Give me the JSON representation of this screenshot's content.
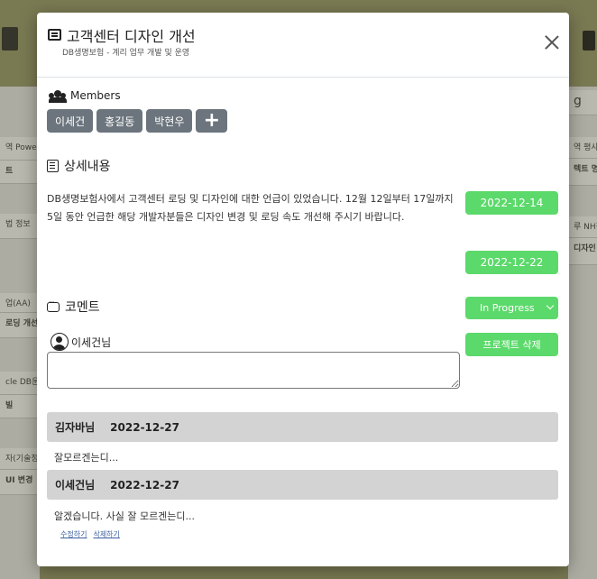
{
  "background": {
    "left_cards": [
      "역 Powe",
      "트",
      "법 정보",
      "업(AA)",
      "로딩 개선",
      "cle DB운",
      "빌",
      "자(기술정",
      "UI 변경"
    ],
    "right_cards": [
      "g",
      "역 평사",
      "텍트 명",
      "루 NH펌",
      "디자인 변"
    ]
  },
  "modal": {
    "title": "고객센터 디자인 개선",
    "subtitle": "DB생명보험 - 계리 업무 개발 및 운영",
    "members_label": "Members",
    "members": [
      "이세건",
      "홍길동",
      "박현우"
    ],
    "add_member": "+",
    "detail_title": "상세내용",
    "description": "DB생명보험사에서 고객센터 로딩 및 디자인에 대한 언급이 있었습니다. 12월 12일부터 17일까지 5일 동안 언급한 해당 개발자분들은 디자인 변경 및 로딩 속도 개선해 주시기 바랍니다.",
    "start_date": "2022-12-14",
    "end_date": "2022-12-22",
    "comment_title": "코멘트",
    "status": "In Progress",
    "delete_label": "프로젝트 삭제",
    "commenter": "이세건님",
    "comment_placeholder": "",
    "comments": [
      {
        "author": "김자바님",
        "date": "2022-12-27",
        "text": "잘모르겐는디..."
      },
      {
        "author": "이세건님",
        "date": "2022-12-27",
        "text": "알겠습니다. 사실 잘 모르겐는디..."
      }
    ],
    "edit_label": "수정하기",
    "delete_comment_label": "삭제하기"
  },
  "colors": {
    "accent": "#5cd96b",
    "member": "#6c757d",
    "comment_header": "#d3d3d3"
  }
}
